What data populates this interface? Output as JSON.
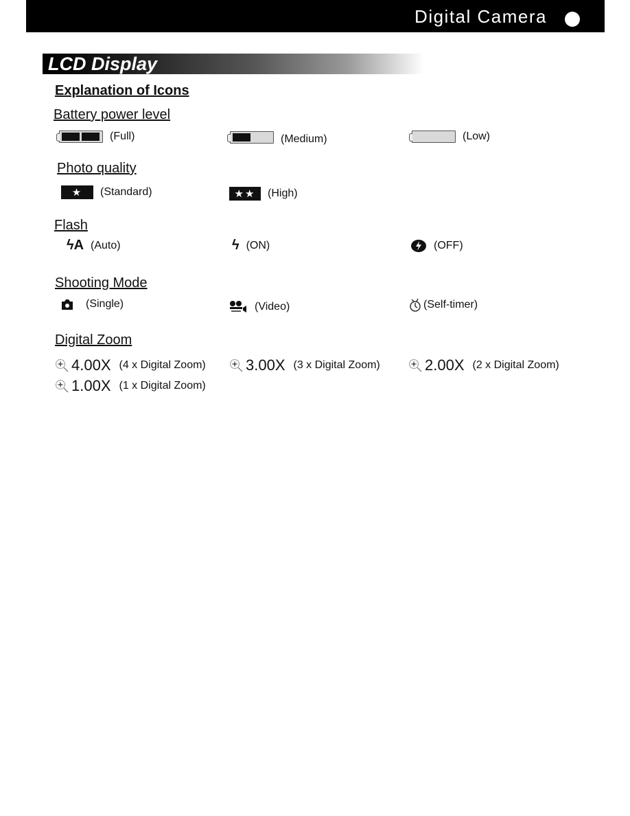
{
  "header": {
    "title": "Digital Camera"
  },
  "banner": {
    "title": "LCD Display"
  },
  "heading": "Explanation of Icons",
  "sections": {
    "battery": {
      "title": "Battery power level",
      "items": [
        {
          "icon": "battery-full-icon",
          "label": "(Full)"
        },
        {
          "icon": "battery-medium-icon",
          "label": "(Medium)"
        },
        {
          "icon": "battery-low-icon",
          "label": "(Low)"
        }
      ]
    },
    "quality": {
      "title": "Photo quality",
      "items": [
        {
          "icon": "star-icon",
          "glyph": "★",
          "label": "(Standard)"
        },
        {
          "icon": "double-star-icon",
          "glyph": "★★",
          "label": "(High)"
        }
      ]
    },
    "flash": {
      "title": "Flash",
      "items": [
        {
          "icon": "flash-auto-icon",
          "glyph": "ϟA",
          "label": "(Auto)"
        },
        {
          "icon": "flash-on-icon",
          "glyph": "ϟ",
          "label": "(ON)"
        },
        {
          "icon": "flash-off-icon",
          "label": "(OFF)"
        }
      ]
    },
    "shooting": {
      "title": "Shooting Mode",
      "items": [
        {
          "icon": "camera-single-icon",
          "label": "(Single)"
        },
        {
          "icon": "video-camera-icon",
          "label": "(Video)"
        },
        {
          "icon": "self-timer-icon",
          "label": "(Self-timer)"
        }
      ]
    },
    "zoom": {
      "title": "Digital Zoom",
      "items": [
        {
          "value": "4.00X",
          "label": "(4 x Digital Zoom)"
        },
        {
          "value": "3.00X",
          "label": "(3 x Digital Zoom)"
        },
        {
          "value": "2.00X",
          "label": "(2 x Digital Zoom)"
        },
        {
          "value": "1.00X",
          "label": "(1 x Digital Zoom)"
        }
      ]
    }
  }
}
